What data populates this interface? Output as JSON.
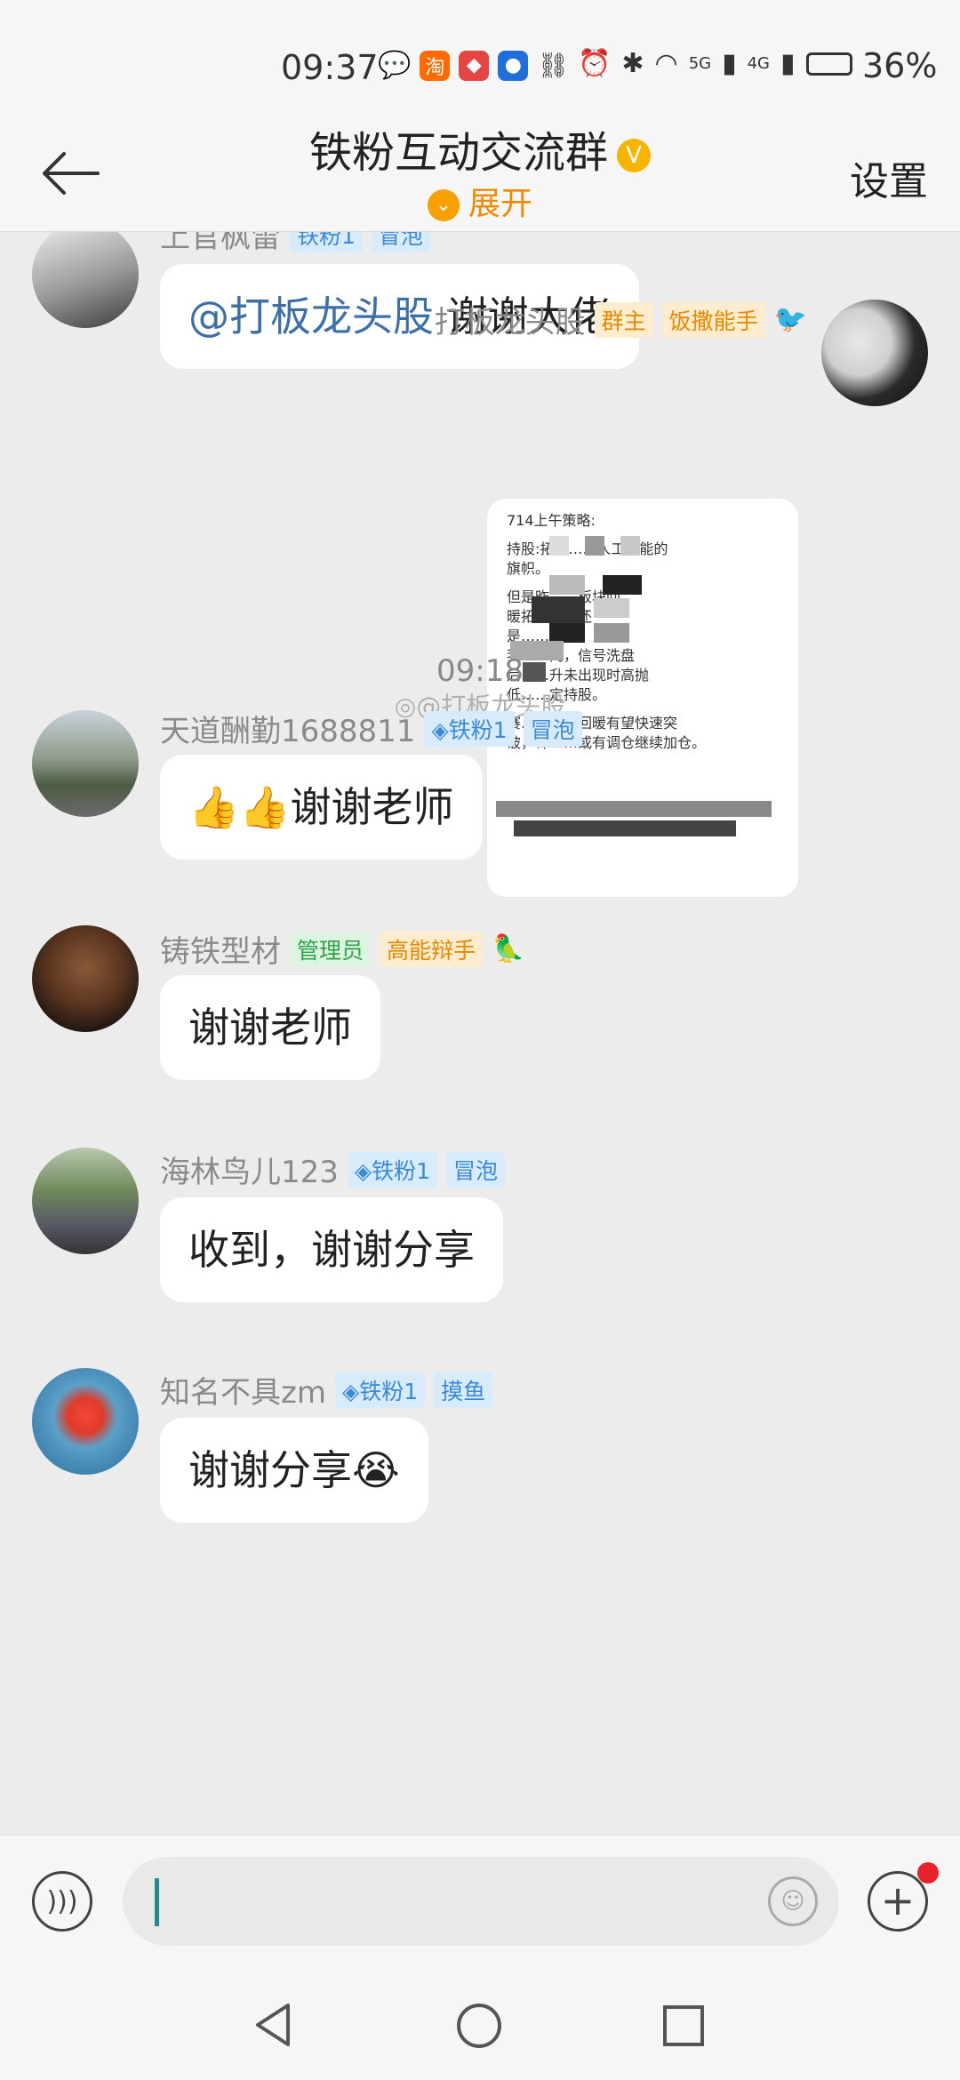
{
  "status_bar": {
    "time": "09:37",
    "network_1": "5G",
    "network_2": "4G",
    "battery": "36%"
  },
  "header": {
    "title": "铁粉互动交流群",
    "expand_label": "展开",
    "settings_label": "设置"
  },
  "messages": [
    {
      "sender": "上官枫雷",
      "tags": [
        "铁粉1",
        "冒泡"
      ],
      "text_mention": "@打板龙头股",
      "text": " 谢谢大佬"
    },
    {
      "sender": "打板龙头股",
      "tags": [
        "群主",
        "饭撒能手"
      ],
      "image_lines": [
        "714上午策略:",
        "持股:拓维……人工智能的",
        "旗帜。",
        "但是昨……板块回",
        "暖拓……盘还",
        "是……",
        "我……内，信号洗盘",
        "后……升未出现时高抛",
        "低……定持股。",
        "赛……汽车回暖有望快速突",
        "破，计……或有调仓继续加仓。"
      ]
    },
    {
      "timestamp": "09:18",
      "watermark": "@打板龙头股"
    },
    {
      "sender": "天道酬勤1688811",
      "tags": [
        "铁粉1",
        "冒泡"
      ],
      "text": "👍👍谢谢老师"
    },
    {
      "sender": "铸铁型材",
      "tags": [
        "管理员",
        "高能辩手"
      ],
      "text": "谢谢老师"
    },
    {
      "sender": "海林鸟儿123",
      "tags": [
        "铁粉1",
        "冒泡"
      ],
      "text": "收到，谢谢分享"
    },
    {
      "sender": "知名不具zm",
      "tags": [
        "铁粉1",
        "摸鱼"
      ],
      "text": "谢谢分享😭"
    }
  ],
  "input": {
    "placeholder": ""
  },
  "colors": {
    "accent": "#f08a00",
    "mention": "#3a6fa8",
    "background": "#ececec"
  },
  "icons": [
    "back-arrow-icon",
    "voice-icon",
    "emoji-icon",
    "plus-icon",
    "nav-back-icon",
    "nav-home-icon",
    "nav-recent-icon"
  ]
}
